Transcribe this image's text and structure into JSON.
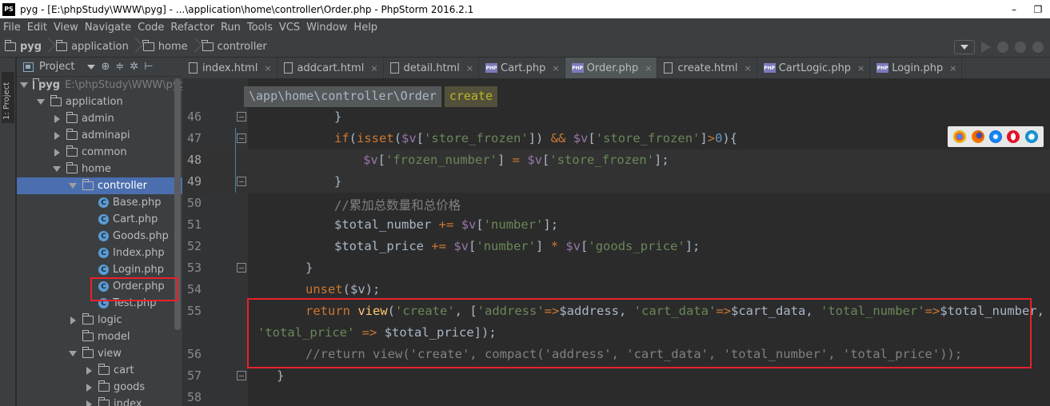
{
  "window": {
    "app_badge": "PS",
    "title": "pyg - [E:\\phpStudy\\WWW\\pyg] - ...\\application\\home\\controller\\Order.php - PhpStorm 2016.2.1",
    "minimize": "–",
    "restore": "❐"
  },
  "menu": [
    {
      "label": "File"
    },
    {
      "label": "Edit"
    },
    {
      "label": "View"
    },
    {
      "label": "Navigate"
    },
    {
      "label": "Code"
    },
    {
      "label": "Refactor"
    },
    {
      "label": "Run"
    },
    {
      "label": "Tools"
    },
    {
      "label": "VCS"
    },
    {
      "label": "Window"
    },
    {
      "label": "Help"
    }
  ],
  "navbar": {
    "crumbs": [
      "pyg",
      "application",
      "home",
      "controller"
    ]
  },
  "sidestrip": {
    "project_tab": "1: Project"
  },
  "project_panel": {
    "title": "Project",
    "icons": [
      "⊕",
      "≑",
      "✲",
      "⊢"
    ],
    "root_name": "pyg",
    "root_path": "E:\\phpStudy\\WWW\\pyg",
    "tree": [
      {
        "label": "application",
        "type": "folder-open"
      },
      {
        "label": "admin",
        "type": "folder-closed"
      },
      {
        "label": "adminapi",
        "type": "folder-closed"
      },
      {
        "label": "common",
        "type": "folder-closed"
      },
      {
        "label": "home",
        "type": "folder-open"
      },
      {
        "label": "controller",
        "type": "folder-open",
        "selected": true
      },
      {
        "label": "Base.php",
        "type": "class"
      },
      {
        "label": "Cart.php",
        "type": "class"
      },
      {
        "label": "Goods.php",
        "type": "class"
      },
      {
        "label": "Index.php",
        "type": "class"
      },
      {
        "label": "Login.php",
        "type": "class"
      },
      {
        "label": "Order.php",
        "type": "class",
        "highlighted": true
      },
      {
        "label": "Test.php",
        "type": "class"
      },
      {
        "label": "logic",
        "type": "folder-closed"
      },
      {
        "label": "model",
        "type": "folder-leaf"
      },
      {
        "label": "view",
        "type": "folder-open"
      },
      {
        "label": "cart",
        "type": "folder-closed"
      },
      {
        "label": "goods",
        "type": "folder-closed"
      },
      {
        "label": "index",
        "type": "folder-closed"
      }
    ]
  },
  "tabs": [
    {
      "label": "index.html",
      "kind": "html"
    },
    {
      "label": "addcart.html",
      "kind": "html"
    },
    {
      "label": "detail.html",
      "kind": "html"
    },
    {
      "label": "Cart.php",
      "kind": "php"
    },
    {
      "label": "Order.php",
      "kind": "php",
      "active": true
    },
    {
      "label": "create.html",
      "kind": "html"
    },
    {
      "label": "CartLogic.php",
      "kind": "php"
    },
    {
      "label": "Login.php",
      "kind": "php"
    }
  ],
  "tab_close": "×",
  "editor": {
    "breadcrumb_path": "\\app\\home\\controller\\Order",
    "breadcrumb_method": "create",
    "line_numbers": [
      "46",
      "47",
      "48",
      "49",
      "50",
      "51",
      "52",
      "53",
      "54",
      "55",
      "",
      "56",
      "57",
      "58"
    ]
  },
  "colors": {
    "selection": "#4b6eaf",
    "highlight_box": "#e8212a",
    "keyword": "#cc7832",
    "string": "#6a8759",
    "variable": "#9876aa",
    "function": "#ffc66d",
    "comment": "#808080"
  },
  "browser_icons": [
    "chrome-icon",
    "firefox-icon",
    "safari-icon",
    "opera-icon",
    "ie-icon"
  ]
}
